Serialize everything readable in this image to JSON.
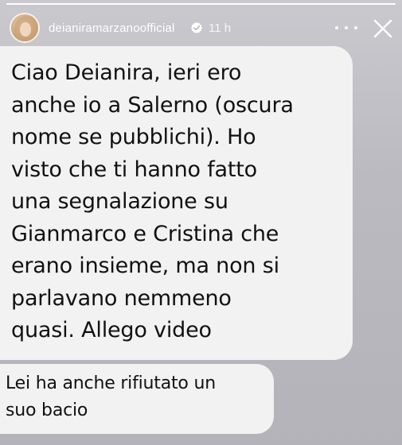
{
  "story": {
    "username": "deianiramarzanoofficial",
    "timestamp": "11 h",
    "progress_fraction": 1.0,
    "verified": true,
    "icons": {
      "avatar": "profile-photo",
      "verified": "verified-badge-icon",
      "more": "more-options-icon",
      "close": "close-icon"
    }
  },
  "messages": [
    {
      "text": "Ciao Deianira, ieri ero\nanche io a Salerno (oscura\nnome se pubblichi). Ho\nvisto che ti hanno fatto\nuna segnalazione su\nGianmarco e Cristina che\nerano insieme, ma non si\nparlavano nemmeno\nquasi. Allego video"
    },
    {
      "text": "Lei ha anche rifiutato un\nsuo bacio"
    }
  ],
  "colors": {
    "background": "#bdbdc2",
    "bubble": "#f2f2f3",
    "text": "#111111",
    "header_text": "#ffffff"
  }
}
